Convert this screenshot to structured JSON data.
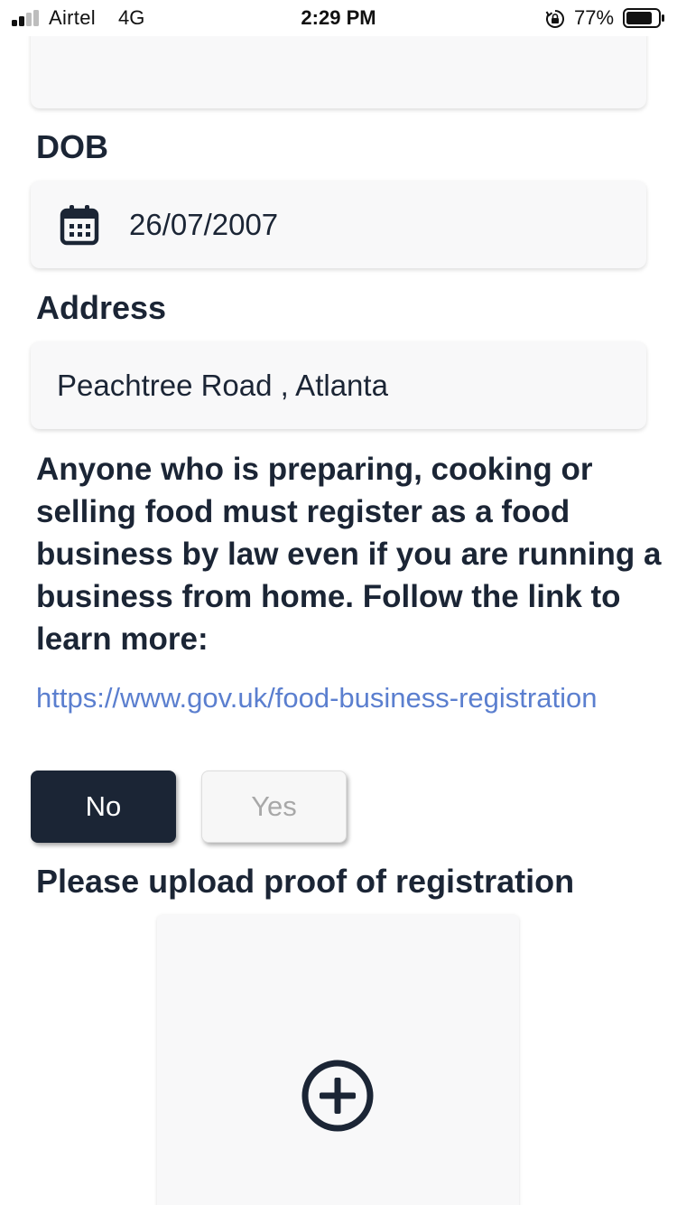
{
  "status_bar": {
    "carrier": "Airtel",
    "network": "4G",
    "time": "2:29 PM",
    "battery_percent": "77%",
    "icons": [
      "signal-icon",
      "orientation-lock-icon",
      "battery-icon"
    ]
  },
  "form": {
    "dob_label": "DOB",
    "dob_value": "26/07/2007",
    "address_label": "Address",
    "address_value": "Peachtree Road , Atlanta",
    "notice_text": "Anyone who is preparing, cooking or selling food must register as a food business by law even if you are running a business from home. Follow the link to learn more:",
    "link_text": "https://www.gov.uk/food-business-registration",
    "choice": {
      "no_label": "No",
      "yes_label": "Yes",
      "selected": "No"
    },
    "upload_label": "Please upload proof of registration"
  },
  "colors": {
    "primary": "#1b2535",
    "link": "#5b7fcf",
    "field_bg": "#f8f8f9"
  }
}
